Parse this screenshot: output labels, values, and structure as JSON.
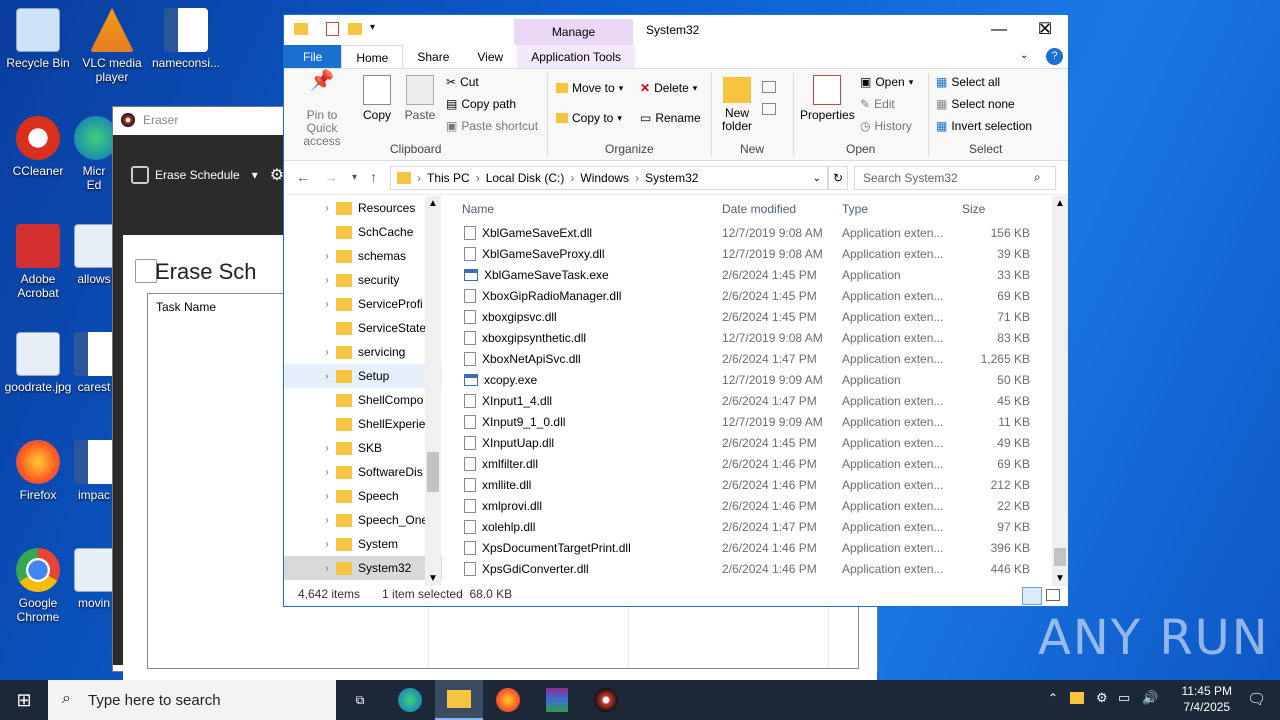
{
  "desktop": {
    "icons": [
      {
        "label": "Recycle Bin",
        "icon": "recycle-bin-icon"
      },
      {
        "label": "VLC media player",
        "icon": "vlc-icon"
      },
      {
        "label": "nameconsi...",
        "icon": "word-doc-icon"
      },
      {
        "label": "CCleaner",
        "icon": "ccleaner-icon"
      },
      {
        "label": "Micr Ed",
        "icon": "edge-icon"
      },
      {
        "label": "Adobe Acrobat",
        "icon": "acrobat-icon"
      },
      {
        "label": "allows",
        "icon": "image-file-icon"
      },
      {
        "label": "goodrate.jpg",
        "icon": "image-file-icon"
      },
      {
        "label": "carest",
        "icon": "word-doc-icon"
      },
      {
        "label": "Firefox",
        "icon": "firefox-icon"
      },
      {
        "label": "impac",
        "icon": "word-doc-icon"
      },
      {
        "label": "Google Chrome",
        "icon": "chrome-icon"
      },
      {
        "label": "movin",
        "icon": "image-file-icon"
      }
    ]
  },
  "eraser": {
    "title": "Eraser",
    "toolbar_label": "Erase Schedule",
    "heading": "Erase Sch",
    "column": "Task Name"
  },
  "explorer": {
    "title": "System32",
    "manage": "Manage",
    "tabs": {
      "file": "File",
      "home": "Home",
      "share": "Share",
      "view": "View",
      "apptools": "Application Tools"
    },
    "ribbon": {
      "pin": "Pin to Quick access",
      "copy": "Copy",
      "paste": "Paste",
      "cut": "Cut",
      "copy_path": "Copy path",
      "paste_shortcut": "Paste shortcut",
      "clipboard": "Clipboard",
      "move_to": "Move to",
      "copy_to": "Copy to",
      "delete": "Delete",
      "rename": "Rename",
      "organize": "Organize",
      "new_folder": "New folder",
      "new": "New",
      "properties": "Properties",
      "open": "Open",
      "edit": "Edit",
      "history": "History",
      "open_group": "Open",
      "select_all": "Select all",
      "select_none": "Select none",
      "invert_selection": "Invert selection",
      "select": "Select"
    },
    "address": {
      "crumbs": [
        "This PC",
        "Local Disk (C:)",
        "Windows",
        "System32"
      ],
      "search_placeholder": "Search System32"
    },
    "tree": [
      "Resources",
      "SchCache",
      "schemas",
      "security",
      "ServiceProfi",
      "ServiceState",
      "servicing",
      "Setup",
      "ShellCompo",
      "ShellExperie",
      "SKB",
      "SoftwareDis",
      "Speech",
      "Speech_One",
      "System",
      "System32"
    ],
    "columns": {
      "name": "Name",
      "date": "Date modified",
      "type": "Type",
      "size": "Size"
    },
    "files": [
      {
        "name": "XblGameSaveExt.dll",
        "date": "12/7/2019 9:08 AM",
        "type": "Application exten...",
        "size": "156 KB",
        "kind": "dll"
      },
      {
        "name": "XblGameSaveProxy.dll",
        "date": "12/7/2019 9:08 AM",
        "type": "Application exten...",
        "size": "39 KB",
        "kind": "dll"
      },
      {
        "name": "XblGameSaveTask.exe",
        "date": "2/6/2024 1:45 PM",
        "type": "Application",
        "size": "33 KB",
        "kind": "exe"
      },
      {
        "name": "XboxGipRadioManager.dll",
        "date": "2/6/2024 1:45 PM",
        "type": "Application exten...",
        "size": "69 KB",
        "kind": "dll"
      },
      {
        "name": "xboxgipsvc.dll",
        "date": "2/6/2024 1:45 PM",
        "type": "Application exten...",
        "size": "71 KB",
        "kind": "dll"
      },
      {
        "name": "xboxgipsynthetic.dll",
        "date": "12/7/2019 9:08 AM",
        "type": "Application exten...",
        "size": "83 KB",
        "kind": "dll"
      },
      {
        "name": "XboxNetApiSvc.dll",
        "date": "2/6/2024 1:47 PM",
        "type": "Application exten...",
        "size": "1,265 KB",
        "kind": "dll"
      },
      {
        "name": "xcopy.exe",
        "date": "12/7/2019 9:09 AM",
        "type": "Application",
        "size": "50 KB",
        "kind": "exe"
      },
      {
        "name": "XInput1_4.dll",
        "date": "2/6/2024 1:47 PM",
        "type": "Application exten...",
        "size": "45 KB",
        "kind": "dll"
      },
      {
        "name": "XInput9_1_0.dll",
        "date": "12/7/2019 9:09 AM",
        "type": "Application exten...",
        "size": "11 KB",
        "kind": "dll"
      },
      {
        "name": "XInputUap.dll",
        "date": "2/6/2024 1:45 PM",
        "type": "Application exten...",
        "size": "49 KB",
        "kind": "dll"
      },
      {
        "name": "xmlfilter.dll",
        "date": "2/6/2024 1:46 PM",
        "type": "Application exten...",
        "size": "69 KB",
        "kind": "dll"
      },
      {
        "name": "xmllite.dll",
        "date": "2/6/2024 1:46 PM",
        "type": "Application exten...",
        "size": "212 KB",
        "kind": "dll"
      },
      {
        "name": "xmlprovi.dll",
        "date": "2/6/2024 1:46 PM",
        "type": "Application exten...",
        "size": "22 KB",
        "kind": "dll"
      },
      {
        "name": "xolehlp.dll",
        "date": "2/6/2024 1:47 PM",
        "type": "Application exten...",
        "size": "97 KB",
        "kind": "dll"
      },
      {
        "name": "XpsDocumentTargetPrint.dll",
        "date": "2/6/2024 1:46 PM",
        "type": "Application exten...",
        "size": "396 KB",
        "kind": "dll"
      },
      {
        "name": "XpsGdiConverter.dll",
        "date": "2/6/2024 1:46 PM",
        "type": "Application exten...",
        "size": "446 KB",
        "kind": "dll"
      }
    ],
    "status": {
      "items": "4,642 items",
      "selected": "1 item selected",
      "size": "68.0 KB"
    }
  },
  "taskbar": {
    "search_placeholder": "Type here to search",
    "time": "11:45 PM",
    "date": "7/4/2025"
  },
  "watermark": "ANY RUN"
}
